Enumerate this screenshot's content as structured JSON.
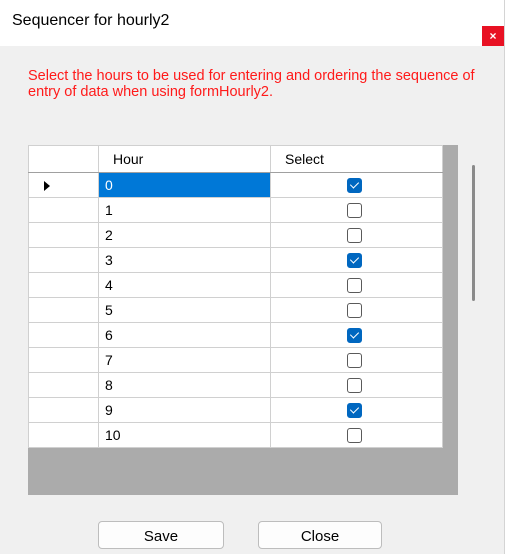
{
  "window": {
    "title": "Sequencer for hourly2",
    "close_glyph": "×"
  },
  "instructions": "Select the hours  to be used for entering and ordering the sequence of entry of data when using formHourly2.",
  "grid": {
    "columns": [
      "Hour",
      "Select"
    ],
    "rows": [
      {
        "hour": "0",
        "select": true,
        "current": true
      },
      {
        "hour": "1",
        "select": false
      },
      {
        "hour": "2",
        "select": false
      },
      {
        "hour": "3",
        "select": true
      },
      {
        "hour": "4",
        "select": false
      },
      {
        "hour": "5",
        "select": false
      },
      {
        "hour": "6",
        "select": true
      },
      {
        "hour": "7",
        "select": false
      },
      {
        "hour": "8",
        "select": false
      },
      {
        "hour": "9",
        "select": true
      },
      {
        "hour": "10",
        "select": false
      }
    ]
  },
  "buttons": {
    "save": "Save",
    "close": "Close"
  },
  "colors": {
    "instruction_text": "#ff1a1a",
    "selected_cell": "#0078d7",
    "checkbox_checked": "#0067c0",
    "title_close_button": "#e81123"
  }
}
